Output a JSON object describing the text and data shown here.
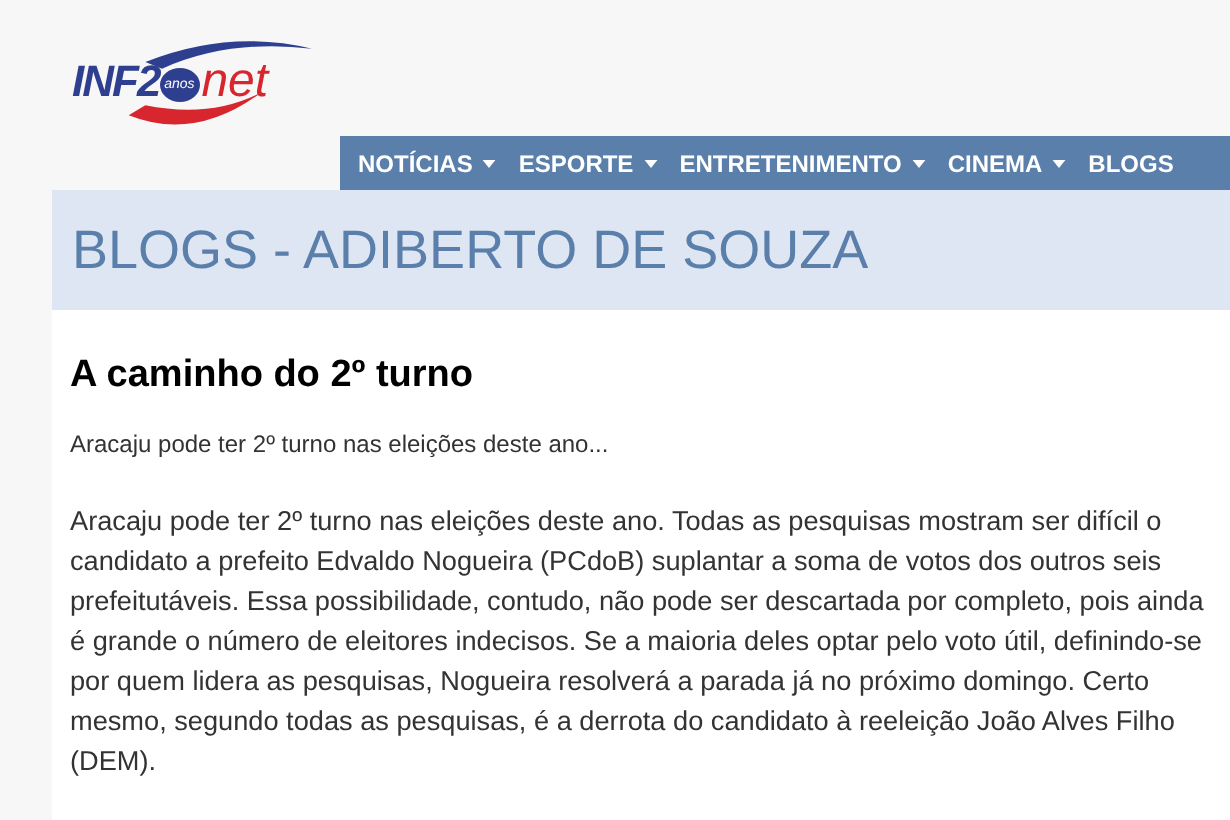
{
  "logo": {
    "left": "INF2",
    "badge": "anos",
    "right": "net"
  },
  "nav": [
    {
      "label": "NOTÍCIAS",
      "dropdown": true
    },
    {
      "label": "ESPORTE",
      "dropdown": true
    },
    {
      "label": "ENTRETENIMENTO",
      "dropdown": true
    },
    {
      "label": "CINEMA",
      "dropdown": true
    },
    {
      "label": "BLOGS",
      "dropdown": false
    }
  ],
  "page_title": "BLOGS - ADIBERTO DE SOUZA",
  "article": {
    "title": "A caminho do 2º turno",
    "summary": "Aracaju pode ter 2º turno nas eleições deste ano...",
    "body": "Aracaju pode ter 2º turno nas eleições deste ano. Todas as pesquisas mostram ser difícil o candidato a prefeito Edvaldo Nogueira (PCdoB) suplantar a soma de votos dos outros seis prefeitutáveis. Essa possibilidade, contudo, não pode ser descartada por completo, pois ainda é grande o número de eleitores indecisos. Se a maioria deles optar pelo voto útil, definindo-se por quem lidera as pesquisas, Nogueira resolverá a parada já no próximo domingo. Certo mesmo, segundo todas as pesquisas, é a derrota do candidato à reeleição João Alves Filho (DEM)."
  }
}
